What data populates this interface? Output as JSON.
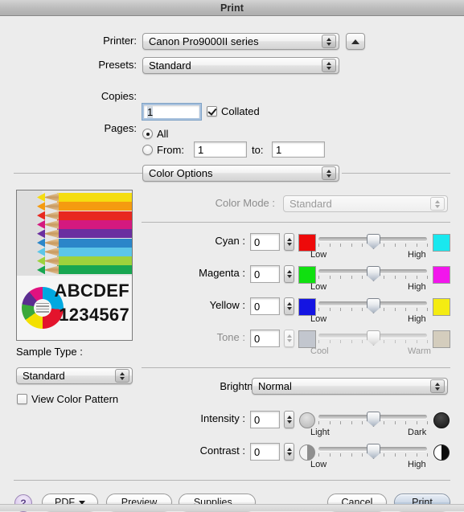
{
  "window": {
    "title": "Print"
  },
  "printer_section": {
    "printer_label": "Printer:",
    "printer_value": "Canon Pro9000II series",
    "eject_icon": "triangle-up-icon",
    "presets_label": "Presets:",
    "presets_value": "Standard",
    "copies_label": "Copies:",
    "copies_value": "1",
    "collated_label": "Collated",
    "collated_checked": true,
    "pages_label": "Pages:",
    "pages_all_label": "All",
    "pages_all_selected": true,
    "pages_from_label": "From:",
    "pages_from_value": "1",
    "pages_to_label": "to:",
    "pages_to_value": "1"
  },
  "pane_selector": {
    "value": "Color Options"
  },
  "preview": {
    "sample_text_letters": "ABCDEF",
    "sample_text_digits": "1234567",
    "sample_type_label": "Sample Type :",
    "sample_type_value": "Standard",
    "view_color_pattern_label": "View Color Pattern",
    "view_color_pattern_checked": false,
    "pencil_colors": [
      "#f5dd10",
      "#f59b10",
      "#e8281f",
      "#d4197f",
      "#6a2fa0",
      "#2b86c9",
      "#5cc6e8",
      "#9ed23c",
      "#18a651"
    ],
    "donut_colors": [
      "#00a8e0",
      "#e3142c",
      "#f3e000",
      "#3aa83a",
      "#5b2d90",
      "#e0127f"
    ]
  },
  "color_mode": {
    "label": "Color Mode :",
    "value": "Standard",
    "disabled": true
  },
  "sliders": [
    {
      "name": "cyan",
      "label": "Cyan :",
      "value": "0",
      "left_swatch": "#ee0a0a",
      "right_swatch": "#19e8ef",
      "low_label": "Low",
      "high_label": "High",
      "disabled": false,
      "position_pct": 50
    },
    {
      "name": "magenta",
      "label": "Magenta :",
      "value": "0",
      "left_swatch": "#10e010",
      "right_swatch": "#f216ec",
      "low_label": "Low",
      "high_label": "High",
      "disabled": false,
      "position_pct": 50
    },
    {
      "name": "yellow",
      "label": "Yellow :",
      "value": "0",
      "left_swatch": "#1414e2",
      "right_swatch": "#f4ec12",
      "low_label": "Low",
      "high_label": "High",
      "disabled": false,
      "position_pct": 50
    },
    {
      "name": "tone",
      "label": "Tone :",
      "value": "0",
      "left_swatch": "#c2c6ce",
      "right_swatch": "#d4cdbd",
      "low_label": "Cool",
      "high_label": "Warm",
      "disabled": true,
      "position_pct": 50
    }
  ],
  "brightness": {
    "label": "Brightness :",
    "value": "Normal"
  },
  "tone_sliders": [
    {
      "name": "intensity",
      "label": "Intensity :",
      "value": "0",
      "low_label": "Light",
      "high_label": "Dark",
      "position_pct": 50
    },
    {
      "name": "contrast",
      "label": "Contrast :",
      "value": "0",
      "low_label": "Low",
      "high_label": "High",
      "position_pct": 50
    }
  ],
  "footer": {
    "help_label": "?",
    "pdf_label": "PDF",
    "preview_label": "Preview",
    "supplies_label": "Supplies...",
    "cancel_label": "Cancel",
    "print_label": "Print"
  }
}
